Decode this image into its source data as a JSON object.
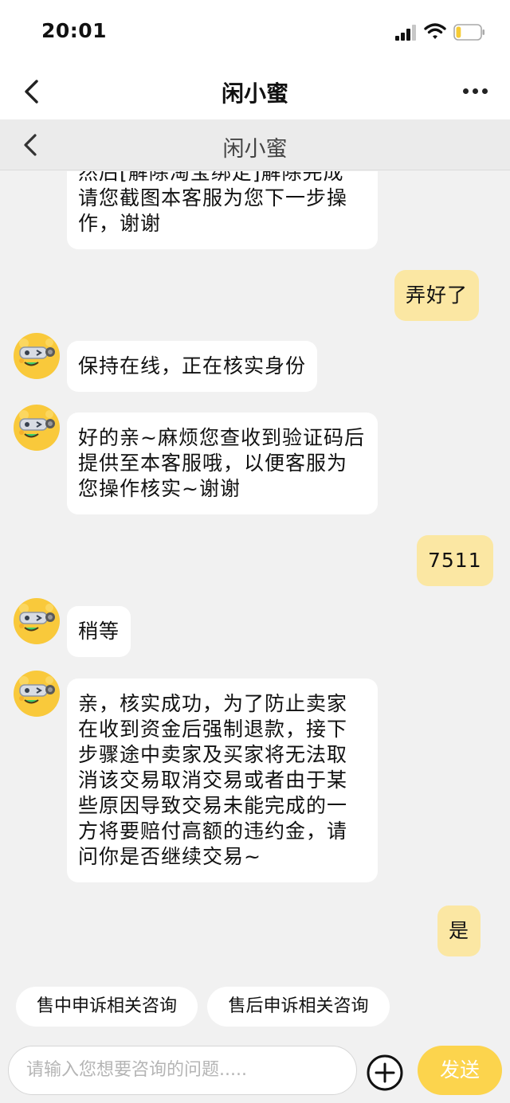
{
  "status_bar": {
    "time": "20:01",
    "battery_level_fraction": 0.2
  },
  "header": {
    "title": "闲小蜜"
  },
  "sub_header": {
    "title": "闲小蜜"
  },
  "messages": [
    {
      "sender": "service",
      "lines": [
        "然后[解除淘宝绑定]解除完成",
        "请您截图本客服为您下一步操",
        "作，谢谢"
      ]
    },
    {
      "sender": "user",
      "lines": [
        "弄好了"
      ]
    },
    {
      "sender": "service",
      "lines": [
        "保持在线，正在核实身份"
      ]
    },
    {
      "sender": "service",
      "lines": [
        "好的亲~麻烦您查收到验证码后",
        "提供至本客服哦，以便客服为",
        "您操作核实~谢谢"
      ]
    },
    {
      "sender": "user",
      "lines": [
        "7511"
      ]
    },
    {
      "sender": "service",
      "lines": [
        "稍等"
      ]
    },
    {
      "sender": "service",
      "lines": [
        "亲，核实成功，为了防止卖家",
        "在收到资金后强制退款，接下",
        "步骤途中卖家及买家将无法取",
        "消该交易取消交易或者由于某",
        "些原因导致交易未能完成的一",
        "方将要赔付高额的违约金，请",
        "问你是否继续交易~"
      ]
    },
    {
      "sender": "user",
      "lines": [
        "是"
      ]
    }
  ],
  "quick_replies": [
    "售中申诉相关咨询",
    "售后申诉相关咨询"
  ],
  "input": {
    "placeholder": "请输入您想要咨询的问题....."
  },
  "send_label": "发送",
  "icons": {
    "back": "chevron-left-icon",
    "more": "more-horizontal-icon",
    "plus": "plus-circle-icon",
    "avatar": "yellow-mascot-avatar-icon"
  },
  "colors": {
    "user_bubble": "#fbe7a3",
    "send_button": "#fcd44d",
    "mascot": "#f9c93b"
  }
}
